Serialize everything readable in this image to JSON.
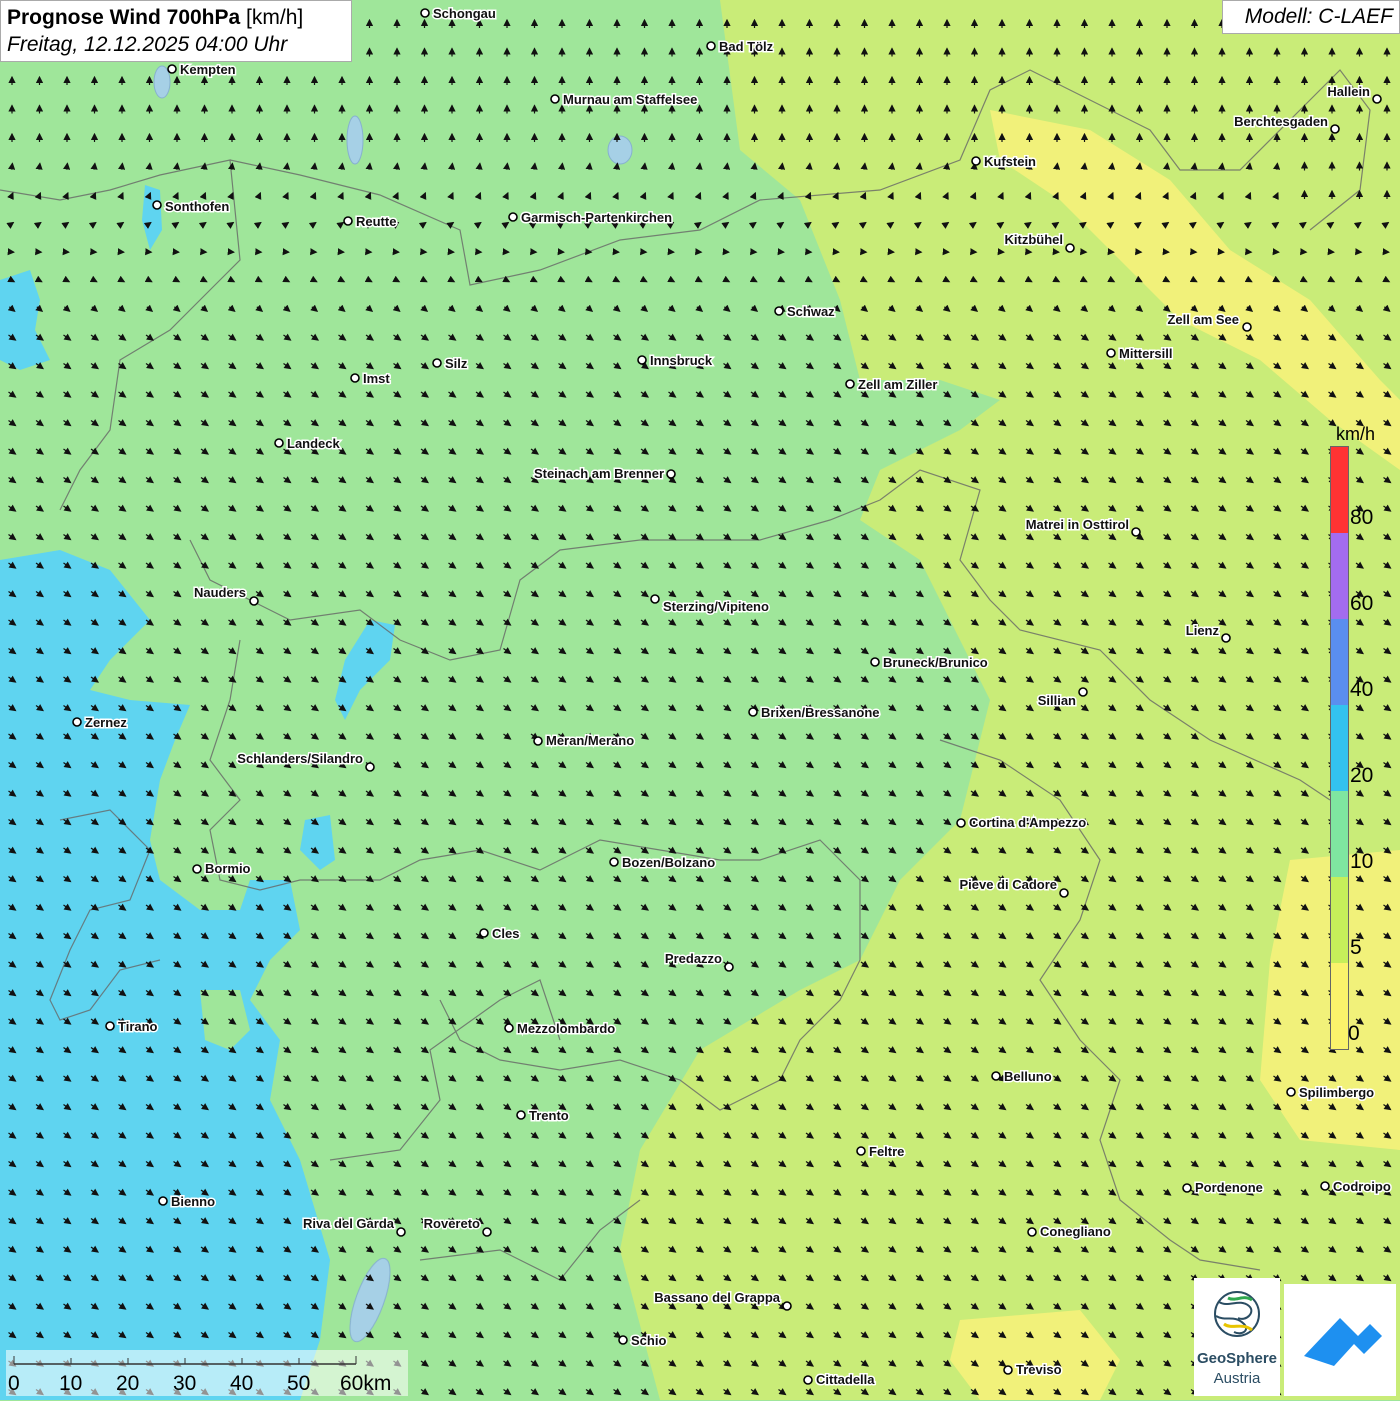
{
  "header": {
    "title_bold": "Prognose Wind 700hPa",
    "title_unit": "[km/h]",
    "datetime": "Freitag, 12.12.2025 04:00 Uhr",
    "model": "Modell: C-LAEF"
  },
  "legend": {
    "unit": "km/h",
    "labels": [
      "80",
      "60",
      "40",
      "20",
      "10",
      "5",
      "0"
    ],
    "colors": [
      "#ff3333",
      "#a36cf0",
      "#5a8ef0",
      "#33c2f0",
      "#7fe6a0",
      "#c6ef5a",
      "#fbf36b"
    ]
  },
  "scalebar": {
    "labels": [
      "0",
      "10",
      "20",
      "30",
      "40",
      "50",
      "60km"
    ]
  },
  "logo": {
    "name_line1": "GeoSphere",
    "name_line2": "Austria"
  },
  "cities": [
    "Schongau",
    "Bad Tölz",
    "Kempten",
    "Murnau am Staffelsee",
    "Hallein",
    "Berchtesgaden",
    "Kufstein",
    "Sonthofen",
    "Reutte",
    "Garmisch-Partenkirchen",
    "Kitzbühel",
    "Schwaz",
    "Zell am See",
    "Mittersill",
    "Innsbruck",
    "Silz",
    "Imst",
    "Zell am Ziller",
    "Landeck",
    "Steinach am Brenner",
    "Matrei in Osttirol",
    "Nauders",
    "Sterzing/Vipiteno",
    "Lienz",
    "Bruneck/Brunico",
    "Sillian",
    "Brixen/Bressanone",
    "Zernez",
    "Meran/Merano",
    "Schlanders/Silandro",
    "Cortina d'Ampezzo",
    "Bozen/Bolzano",
    "Bormio",
    "Pieve di Cadore",
    "Cles",
    "Predazzo",
    "Tirano",
    "Mezzolombardo",
    "Belluno",
    "Spilimbergo",
    "Trento",
    "Feltre",
    "Pordenone",
    "Codroipo",
    "Bienno",
    "Riva del Garda",
    "Rovereto",
    "Conegliano",
    "Bassano del Grappa",
    "Schio",
    "Treviso",
    "Cittadella"
  ]
}
